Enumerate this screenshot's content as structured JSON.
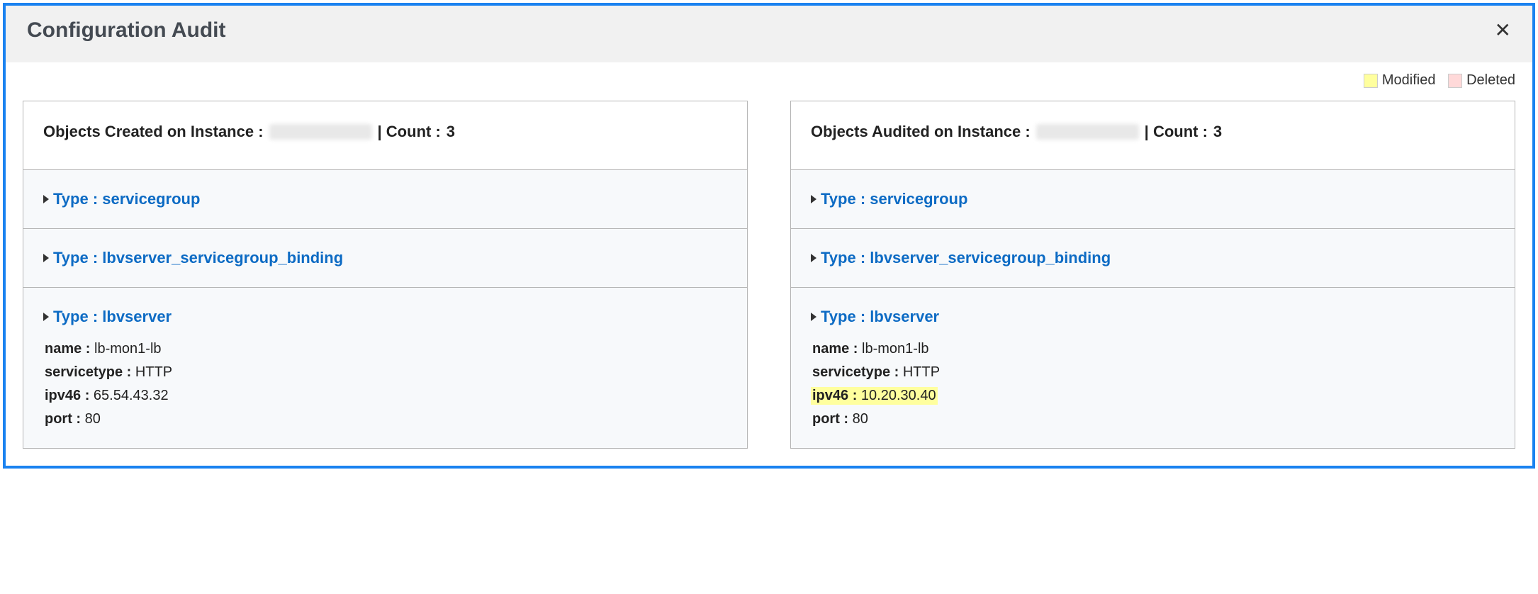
{
  "header": {
    "title": "Configuration Audit"
  },
  "legend": {
    "modified": "Modified",
    "deleted": "Deleted",
    "colors": {
      "modified": "#ffff9e",
      "deleted": "#ffd9d9"
    }
  },
  "panels": {
    "created": {
      "header_prefix": "Objects Created on Instance :",
      "count_prefix": "| Count :",
      "count": "3",
      "sections": [
        {
          "type_label": "Type : servicegroup",
          "details": []
        },
        {
          "type_label": "Type : lbvserver_servicegroup_binding",
          "details": []
        },
        {
          "type_label": "Type : lbvserver",
          "details": [
            {
              "key": "name :",
              "value": "lb-mon1-lb",
              "highlight": "none"
            },
            {
              "key": "servicetype :",
              "value": "HTTP",
              "highlight": "none"
            },
            {
              "key": "ipv46 :",
              "value": "65.54.43.32",
              "highlight": "none"
            },
            {
              "key": "port :",
              "value": "80",
              "highlight": "none"
            }
          ]
        }
      ]
    },
    "audited": {
      "header_prefix": "Objects Audited on Instance :",
      "count_prefix": "| Count :",
      "count": "3",
      "sections": [
        {
          "type_label": "Type : servicegroup",
          "details": []
        },
        {
          "type_label": "Type : lbvserver_servicegroup_binding",
          "details": []
        },
        {
          "type_label": "Type : lbvserver",
          "details": [
            {
              "key": "name :",
              "value": "lb-mon1-lb",
              "highlight": "none"
            },
            {
              "key": "servicetype :",
              "value": "HTTP",
              "highlight": "none"
            },
            {
              "key": "ipv46 :",
              "value": "10.20.30.40",
              "highlight": "modified"
            },
            {
              "key": "port :",
              "value": "80",
              "highlight": "none"
            }
          ]
        }
      ]
    }
  }
}
